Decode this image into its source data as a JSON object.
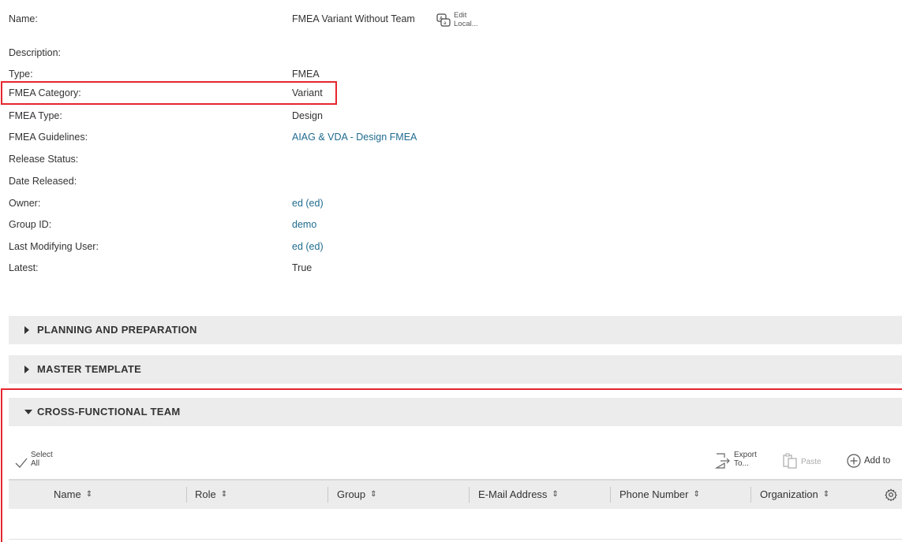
{
  "properties": [
    {
      "label": "Name:",
      "value": "FMEA Variant Without Team",
      "link": false
    },
    {
      "label": "Description:",
      "value": "",
      "link": false
    },
    {
      "label": "Type:",
      "value": "FMEA",
      "link": false
    },
    {
      "label": "FMEA Category:",
      "value": "Variant",
      "link": false
    },
    {
      "label": "FMEA Type:",
      "value": "Design",
      "link": false
    },
    {
      "label": "FMEA Guidelines:",
      "value": "AIAG & VDA - Design FMEA",
      "link": true
    },
    {
      "label": "Release Status:",
      "value": "",
      "link": false
    },
    {
      "label": "Date Released:",
      "value": "",
      "link": false
    },
    {
      "label": "Owner:",
      "value": "ed (ed)",
      "link": true
    },
    {
      "label": "Group ID:",
      "value": "demo",
      "link": true
    },
    {
      "label": "Last Modifying User:",
      "value": "ed (ed)",
      "link": true
    },
    {
      "label": "Latest:",
      "value": "True",
      "link": false
    }
  ],
  "edit_local": {
    "line1": "Edit",
    "line2": "Local..."
  },
  "sections": {
    "planning": "PLANNING AND PREPARATION",
    "master": "MASTER TEMPLATE",
    "team": "CROSS-FUNCTIONAL TEAM"
  },
  "toolbar": {
    "select_all_1": "Select",
    "select_all_2": "All",
    "export_1": "Export",
    "export_2": "To...",
    "paste": "Paste",
    "add_to": "Add to"
  },
  "grid": {
    "columns": [
      "Name",
      "Role",
      "Group",
      "E-Mail Address",
      "Phone Number",
      "Organization"
    ],
    "sort_glyph": "⇕"
  },
  "colors": {
    "highlight": "#e5262e",
    "link": "#1f6b8f",
    "section_bg": "#ececec"
  }
}
